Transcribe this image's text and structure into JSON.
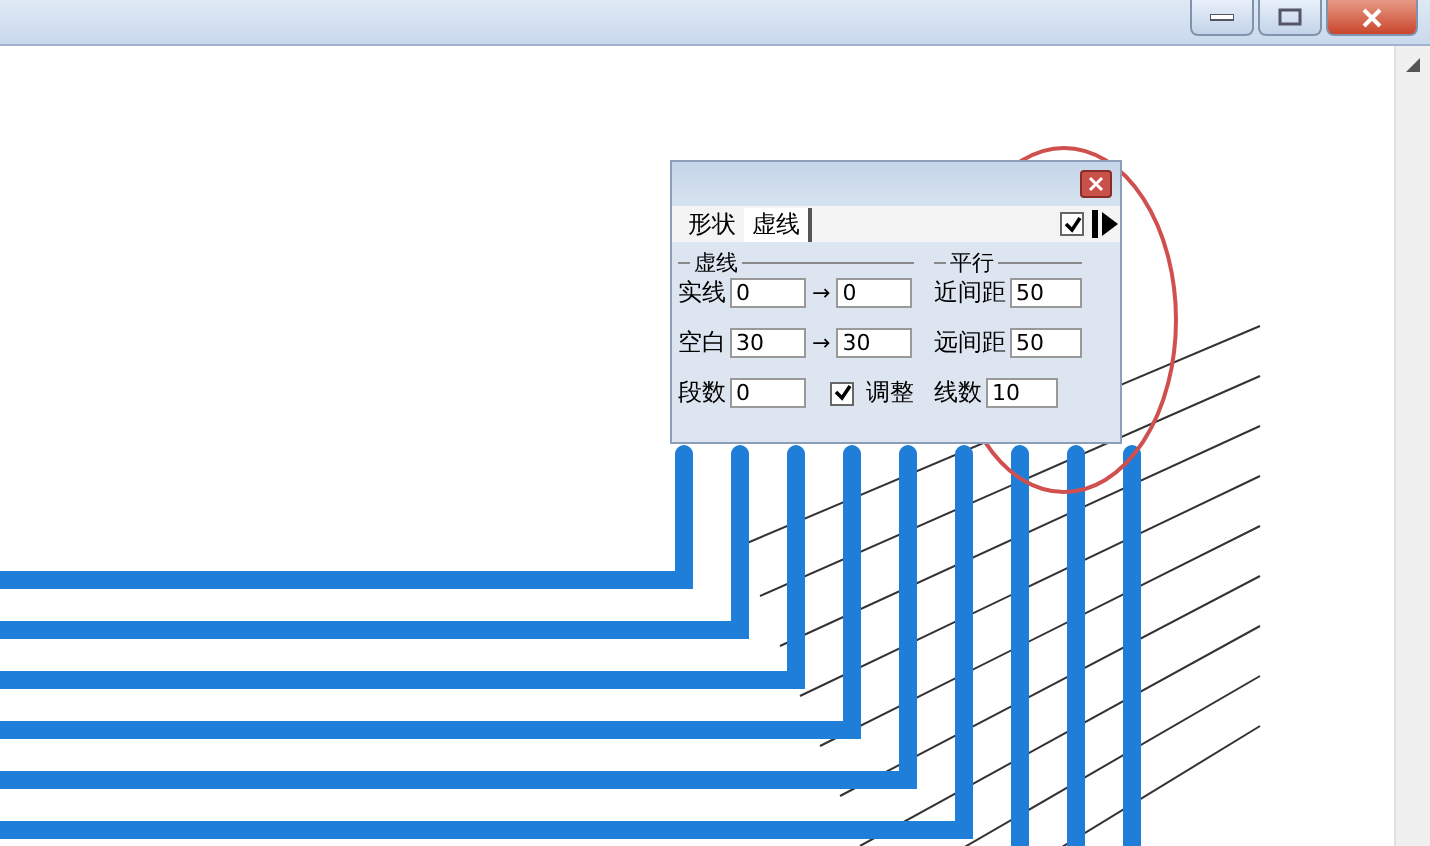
{
  "panel": {
    "tabs": [
      {
        "label": "形状",
        "selected": false
      },
      {
        "label": "虚线",
        "selected": true
      }
    ],
    "enabled": {
      "checked": true
    },
    "dash_group": {
      "title": "虚线",
      "rows": [
        {
          "label": "实线",
          "from": "0",
          "arrow": "→",
          "to": "0"
        },
        {
          "label": "空白",
          "from": "30",
          "arrow": "→",
          "to": "30"
        }
      ],
      "segments": {
        "label": "段数",
        "value": "0"
      },
      "adjust": {
        "label": "调整",
        "checked": true
      }
    },
    "parallel_group": {
      "title": "平行",
      "rows": [
        {
          "label": "近间距",
          "value": "50"
        },
        {
          "label": "远间距",
          "value": "50"
        },
        {
          "label": "线数",
          "value": "10"
        }
      ]
    }
  }
}
